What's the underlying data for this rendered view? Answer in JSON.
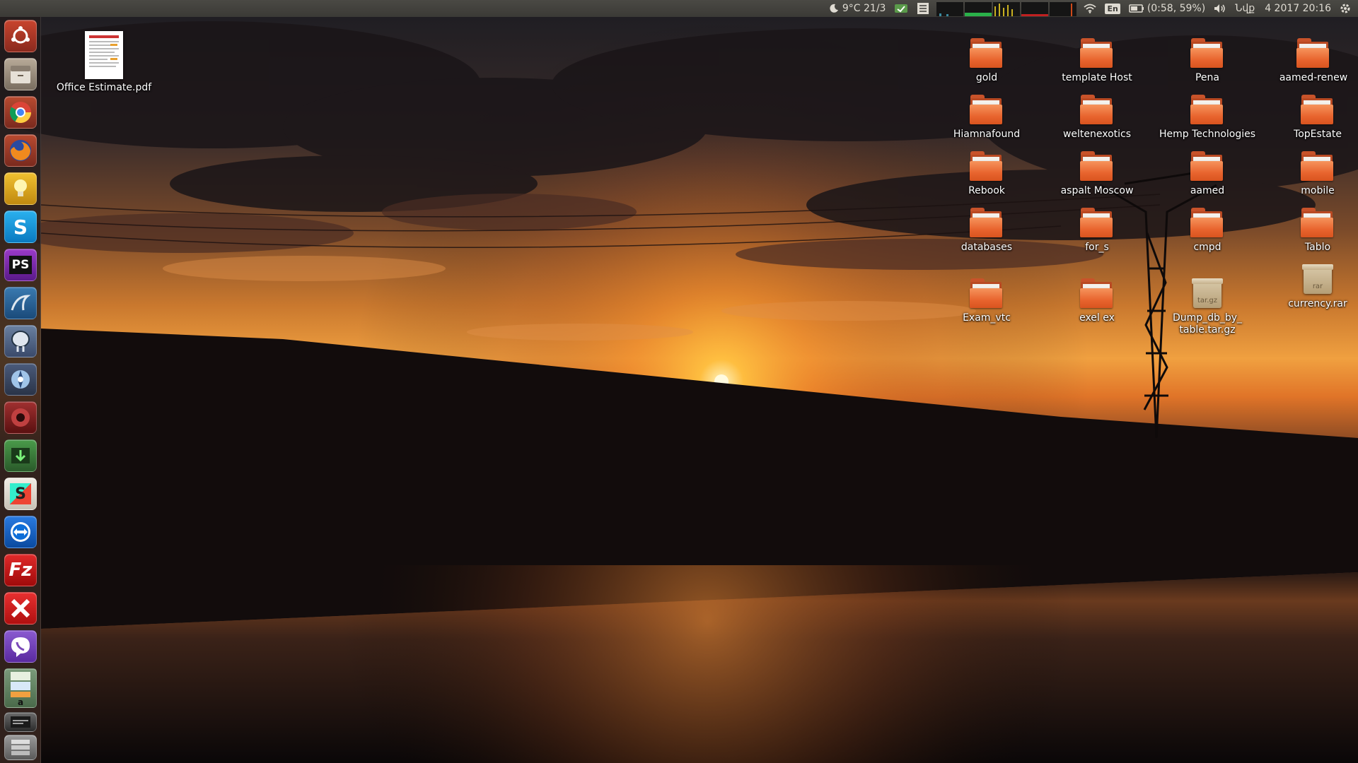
{
  "top_panel": {
    "weather": "9°C 21/3",
    "battery": "(0:58, 59%)",
    "keyboard_lang": "En",
    "clock_prefix": "Նվք",
    "clock": "4 2017 20:16",
    "icons": [
      "moon-icon",
      "network-applet-icon",
      "notes-icon",
      "system-monitor",
      "wifi-icon",
      "battery-icon",
      "volume-icon",
      "settings-gear-icon"
    ]
  },
  "launcher": {
    "items": [
      {
        "name": "ubuntu-dash-icon",
        "color": "#b23a2a"
      },
      {
        "name": "files-icon",
        "color": "#9a8a78"
      },
      {
        "name": "chrome-icon",
        "color": "#9a3a2a"
      },
      {
        "name": "firefox-icon",
        "color": "#a0342a"
      },
      {
        "name": "bulb-icon",
        "color": "#d8a21c"
      },
      {
        "name": "skype-icon",
        "color": "#1ea1e0"
      },
      {
        "name": "phpstorm-icon",
        "color": "#7a2aa0"
      },
      {
        "name": "mysql-workbench-icon",
        "color": "#2a5a8a"
      },
      {
        "name": "pgadmin-icon",
        "color": "#5a6e8e"
      },
      {
        "name": "shutter-icon",
        "color": "#4a5a7a"
      },
      {
        "name": "screen-recorder-icon",
        "color": "#8a2a2a"
      },
      {
        "name": "downloader-icon",
        "color": "#3a7a3a"
      },
      {
        "name": "slack-s-icon",
        "color": "#e8e4dc"
      },
      {
        "name": "teamviewer-icon",
        "color": "#1e6ad8"
      },
      {
        "name": "filezilla-icon",
        "color": "#c41e1e"
      },
      {
        "name": "crossover-icon",
        "color": "#d42020"
      },
      {
        "name": "viber-icon",
        "color": "#7a4ab8"
      },
      {
        "name": "libreoffice-stack-icon",
        "color": "#6a8a6a"
      },
      {
        "name": "text-editor-icon",
        "color": "#4a4a4a"
      },
      {
        "name": "trash-stack-icon",
        "color": "#7a7a7a"
      }
    ],
    "glyphs": {
      "phpstorm": "PS",
      "skype": "S",
      "slack": "S",
      "filezilla": "Fz",
      "amazon": "a"
    }
  },
  "desktop": {
    "pdf": {
      "label": "Office Estimate.pdf"
    },
    "folders": [
      {
        "label": "gold"
      },
      {
        "label": "template Host"
      },
      {
        "label": "Pena"
      },
      {
        "label": "aamed-renew"
      },
      {
        "label": "Hiamnafound"
      },
      {
        "label": "weltenexotics"
      },
      {
        "label": "Hemp Technologies"
      },
      {
        "label": "TopEstate"
      },
      {
        "label": "Rebook"
      },
      {
        "label": "aspalt Moscow"
      },
      {
        "label": "aamed"
      },
      {
        "label": "mobile"
      },
      {
        "label": "databases"
      },
      {
        "label": "for_s"
      },
      {
        "label": "cmpd"
      },
      {
        "label": "Tablo"
      },
      {
        "label": "Exam_vtc"
      },
      {
        "label": "exel ex"
      }
    ],
    "archives": [
      {
        "label": "Dump_db_by_\ntable.tar.gz",
        "ext": "tar.gz"
      },
      {
        "label": "currency.rar",
        "ext": "rar"
      }
    ]
  }
}
